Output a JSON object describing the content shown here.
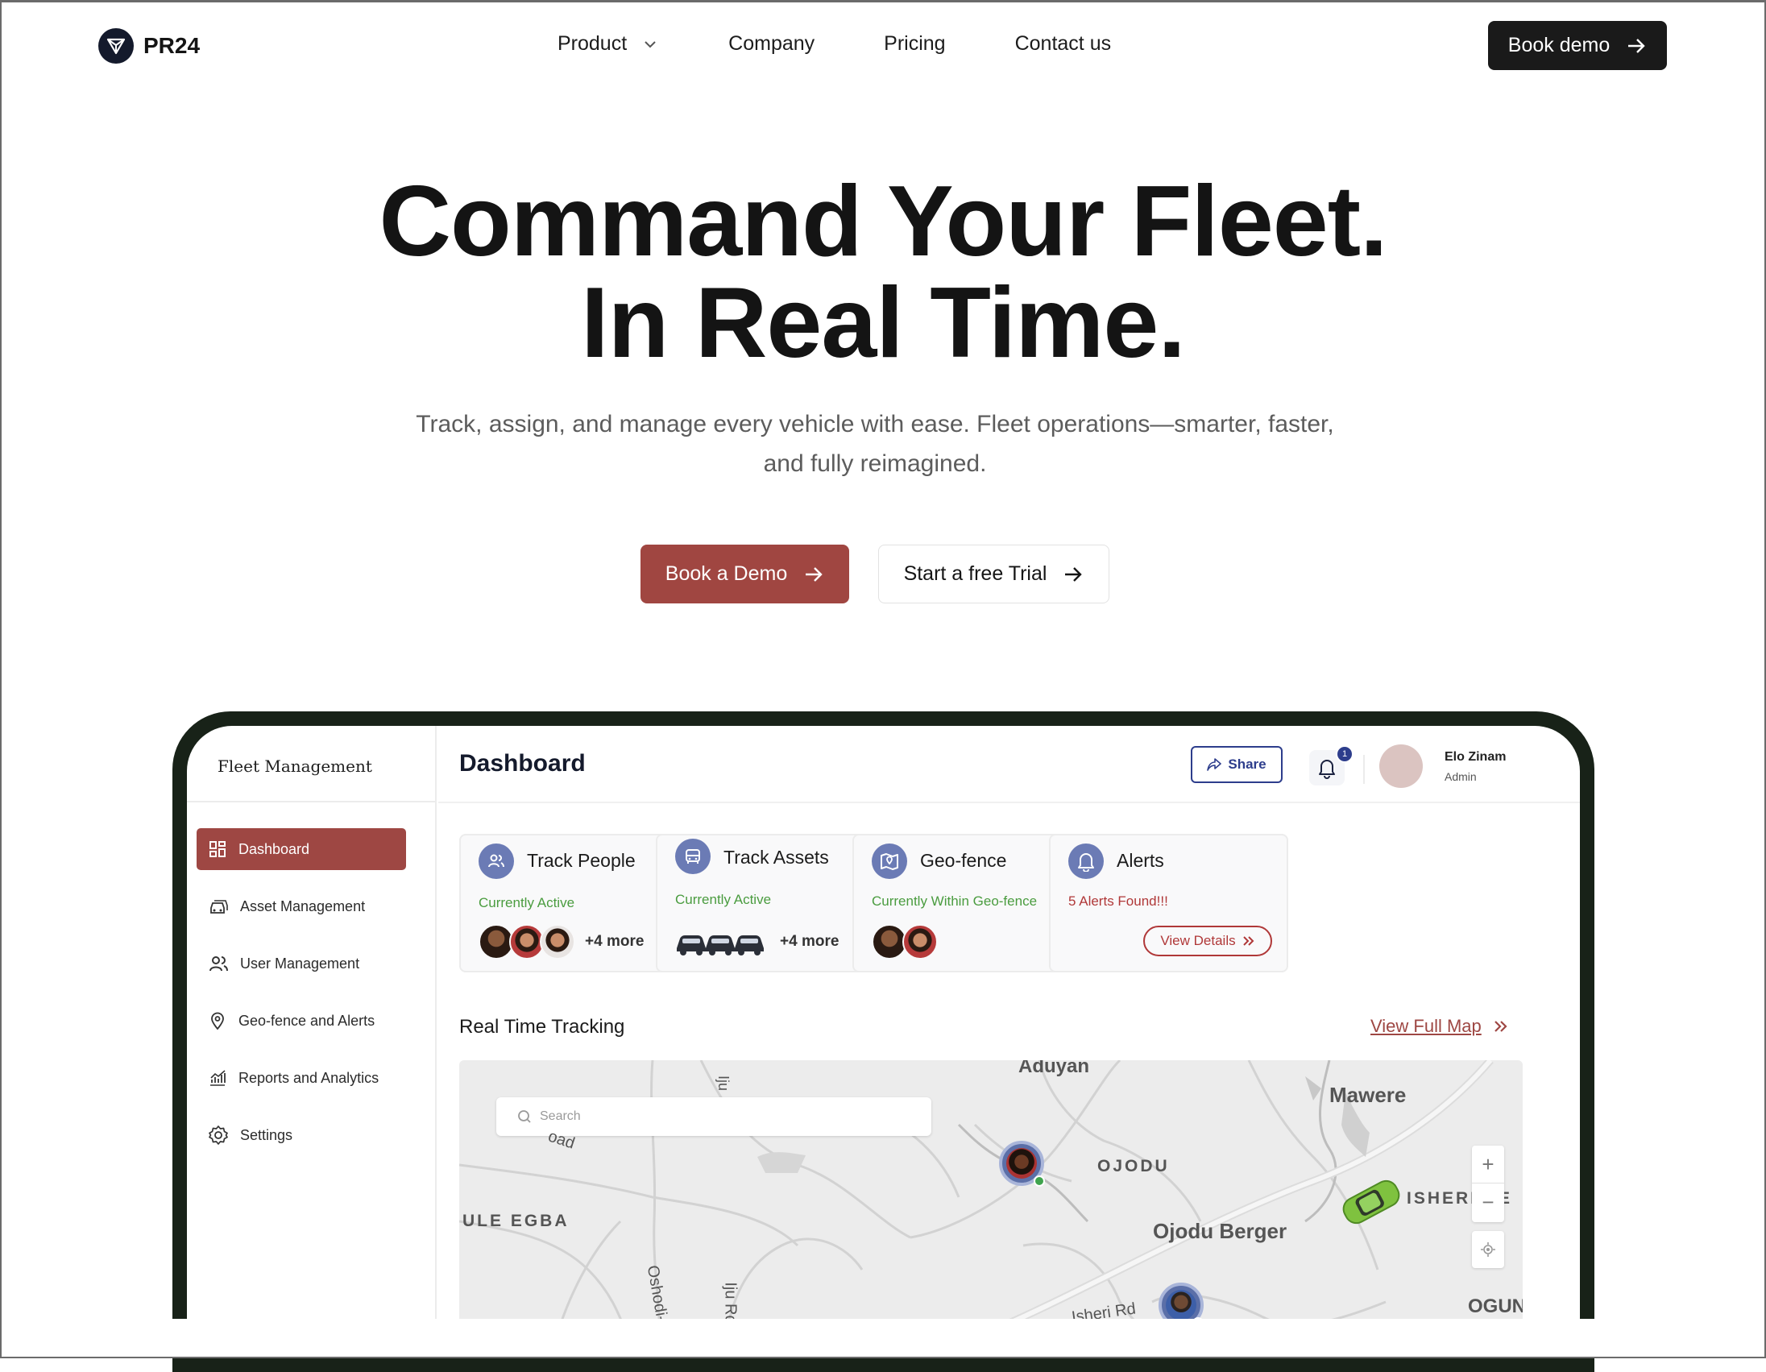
{
  "brand": {
    "name": "PR24"
  },
  "nav": {
    "items": [
      {
        "label": "Product"
      },
      {
        "label": "Company"
      },
      {
        "label": "Pricing"
      },
      {
        "label": "Contact us"
      }
    ],
    "cta": "Book demo"
  },
  "hero": {
    "title_line1": "Command Your Fleet.",
    "title_line2": "In Real Time.",
    "subtitle_line1": "Track, assign, and manage every vehicle with ease. Fleet operations—smarter, faster,",
    "subtitle_line2": "and fully reimagined.",
    "primary_button": "Book a Demo",
    "secondary_button": "Start a free Trial"
  },
  "app": {
    "sidebar": {
      "brand": "Fleet Management",
      "items": [
        {
          "label": "Dashboard",
          "icon": "grid-icon"
        },
        {
          "label": "Asset Management",
          "icon": "car-icon"
        },
        {
          "label": "User Management",
          "icon": "users-icon"
        },
        {
          "label": "Geo-fence and Alerts",
          "icon": "location-pin-icon"
        },
        {
          "label": "Reports and Analytics",
          "icon": "chart-icon"
        },
        {
          "label": "Settings",
          "icon": "gear-icon"
        }
      ]
    },
    "header": {
      "title": "Dashboard",
      "share_label": "Share",
      "notification_count": "1",
      "user_name": "Elo Zinam",
      "user_role": "Admin"
    },
    "cards": [
      {
        "title": "Track People",
        "subtitle": "Currently Active",
        "more": "+4 more",
        "icon": "people-icon"
      },
      {
        "title": "Track Assets",
        "subtitle": "Currently Active",
        "more": "+4 more",
        "icon": "car-icon"
      },
      {
        "title": "Geo-fence",
        "subtitle": "Currently Within Geo-fence",
        "icon": "map-icon"
      },
      {
        "title": "Alerts",
        "subtitle": "5 Alerts Found!!!",
        "action": "View Details",
        "icon": "bell-icon"
      }
    ],
    "tracking": {
      "title": "Real Time Tracking",
      "link": "View Full Map",
      "search_placeholder": "Search",
      "map_labels": {
        "aduyan": "Aduyan",
        "mawere": "Mawere",
        "ojodu": "OJODU",
        "ule_egba": "ULE EGBA",
        "ojodu_berger": "Ojodu Berger",
        "isheri": "ISHERI",
        "isheri_rd": "Isheri Rd",
        "ogun": "OGUN",
        "oshodi": "Oshodi-Eg",
        "iju_rd": "Iju Rd",
        "iju": "Iju",
        "road": "oad",
        "partial_e": "E"
      }
    }
  },
  "colors": {
    "accent": "#a04641",
    "dark": "#1a1a1a",
    "navy": "#2d3d8c",
    "active_green": "#4a9c3f",
    "alert_red": "#b03838"
  }
}
